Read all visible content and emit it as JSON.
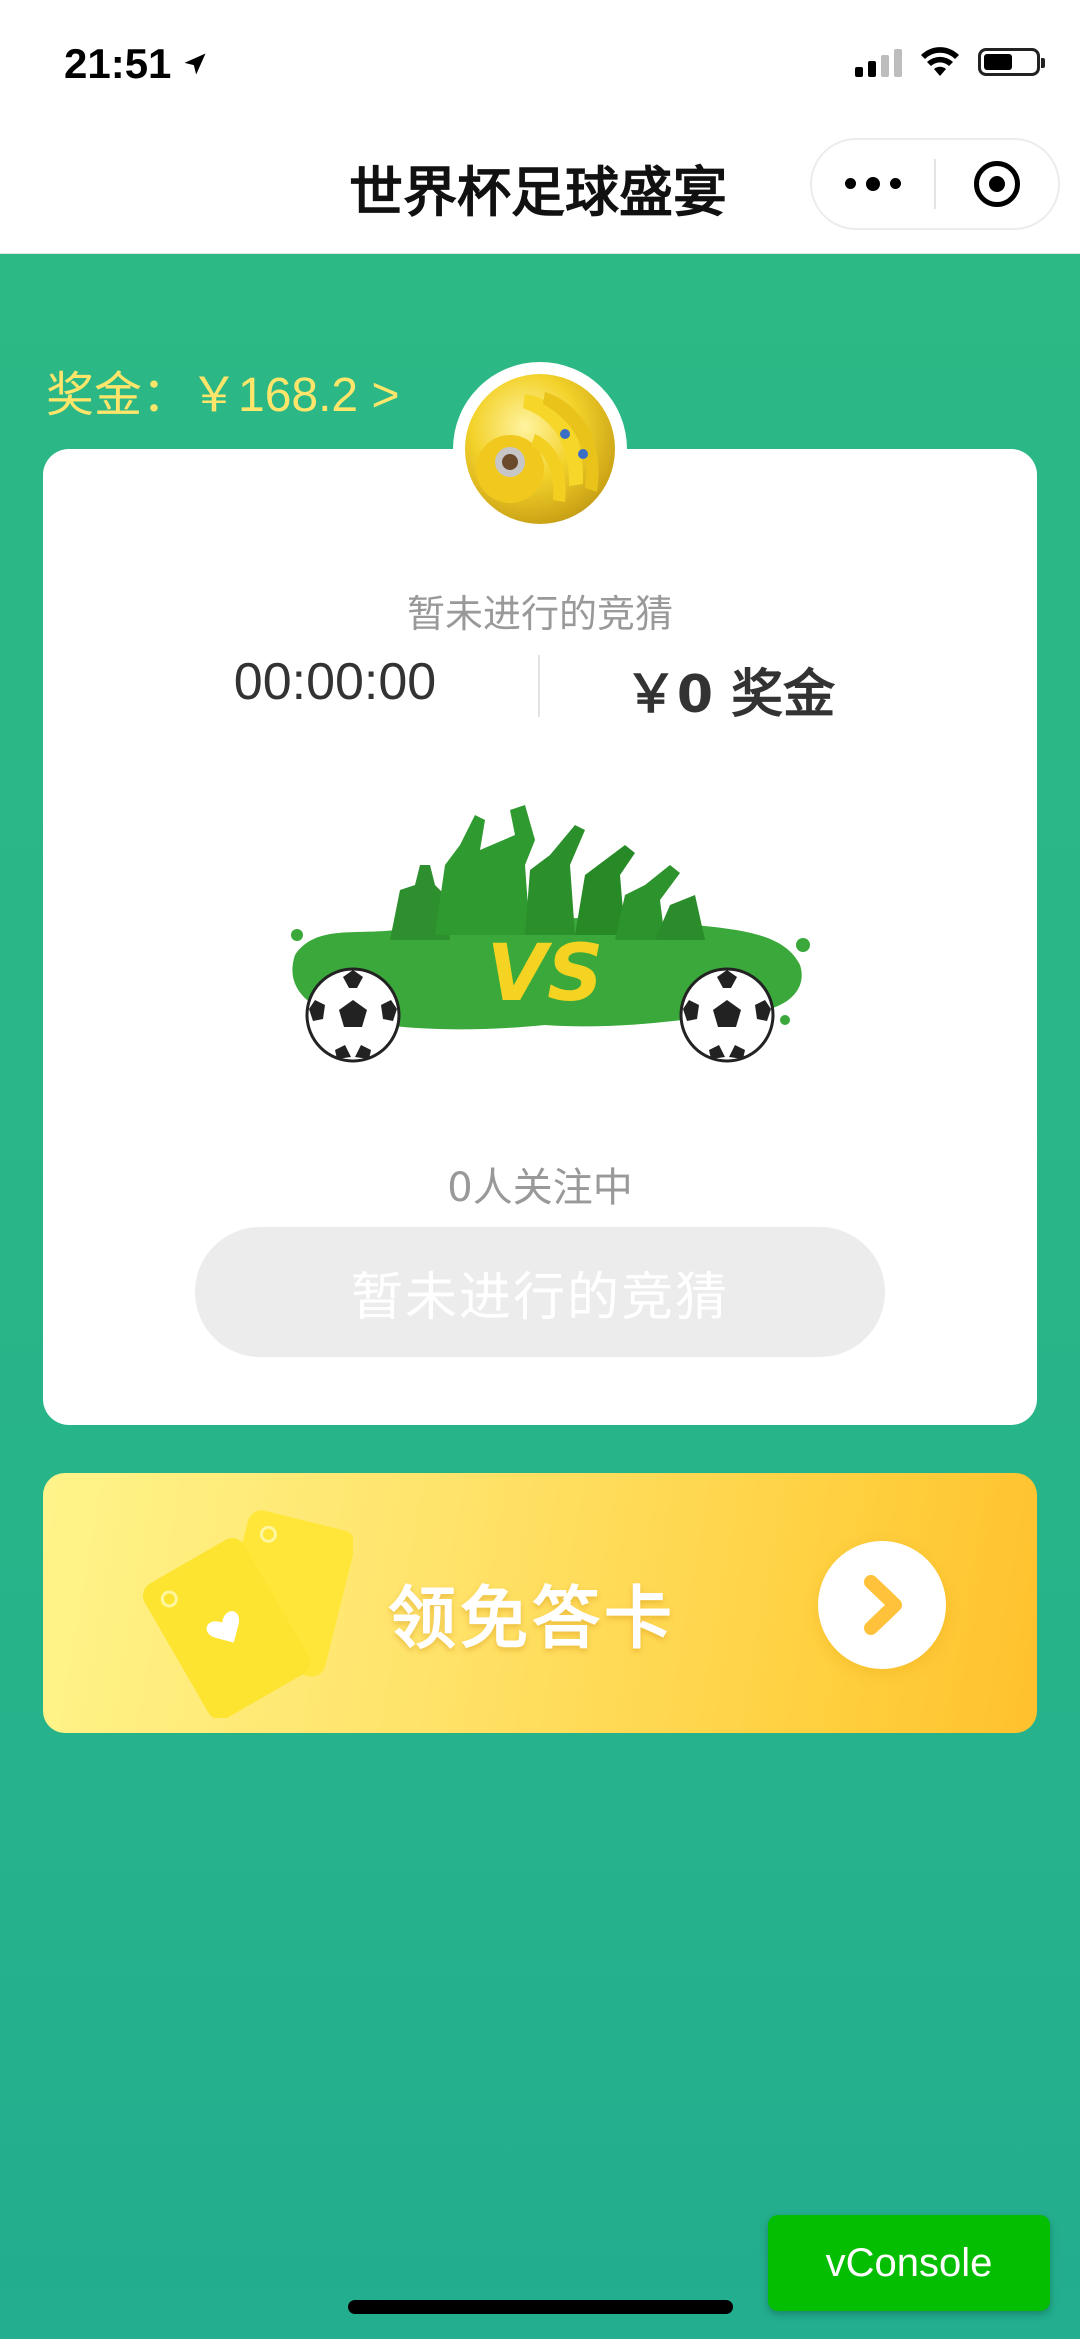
{
  "status_bar": {
    "time": "21:51",
    "icons": [
      "location-arrow-icon",
      "cellular-signal-icon",
      "wifi-icon",
      "battery-icon"
    ]
  },
  "nav": {
    "title": "世界杯足球盛宴",
    "icons": [
      "more-dots-icon",
      "close-target-icon"
    ]
  },
  "prize": {
    "label": "奖金：￥168.2 >"
  },
  "card": {
    "status_text": "暂未进行的竞猜",
    "timer": "00:00:00",
    "reward": "￥0 奖金",
    "followers": "0人关注中",
    "button_label": "暂未进行的竞猜",
    "illustration_text": "VS"
  },
  "banner": {
    "label": "领免答卡"
  },
  "vconsole": {
    "label": "vConsole"
  },
  "colors": {
    "background": "#2bb685",
    "prize_text": "#ffe66b",
    "banner_start": "#fff48a",
    "banner_end": "#ffc12d",
    "vconsole": "#04be02"
  }
}
